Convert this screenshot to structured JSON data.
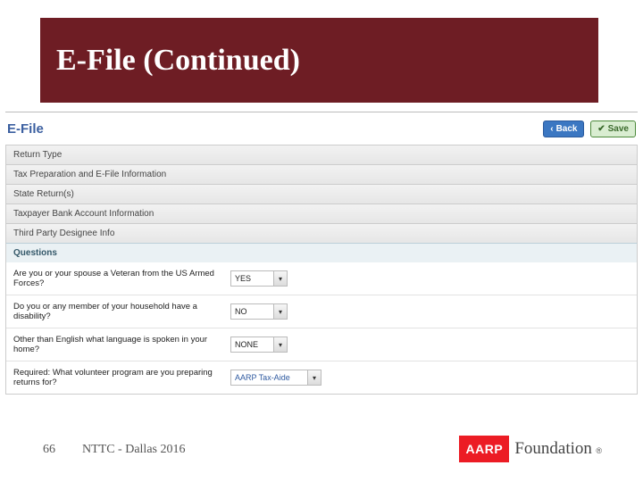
{
  "slide": {
    "title": "E-File (Continued)",
    "page_number": "66",
    "footer_note": "NTTC - Dallas 2016"
  },
  "app": {
    "page_title": "E-File",
    "buttons": {
      "back": "Back",
      "save": "Save"
    },
    "sections": [
      "Return Type",
      "Tax Preparation and E-File Information",
      "State Return(s)",
      "Taxpayer Bank Account Information",
      "Third Party Designee Info"
    ],
    "questions_header": "Questions",
    "questions": [
      {
        "label": "Are you or your spouse a Veteran from the US Armed Forces?",
        "value": "YES"
      },
      {
        "label": "Do you or any member of your household have a disability?",
        "value": "NO"
      },
      {
        "label": "Other than English what language is spoken in your home?",
        "value": "NONE"
      },
      {
        "label": "Required: What volunteer program are you preparing returns for?",
        "value": "AARP Tax-Aide"
      }
    ]
  },
  "logo": {
    "brand": "AARP",
    "word": "Foundation",
    "reg": "®"
  }
}
